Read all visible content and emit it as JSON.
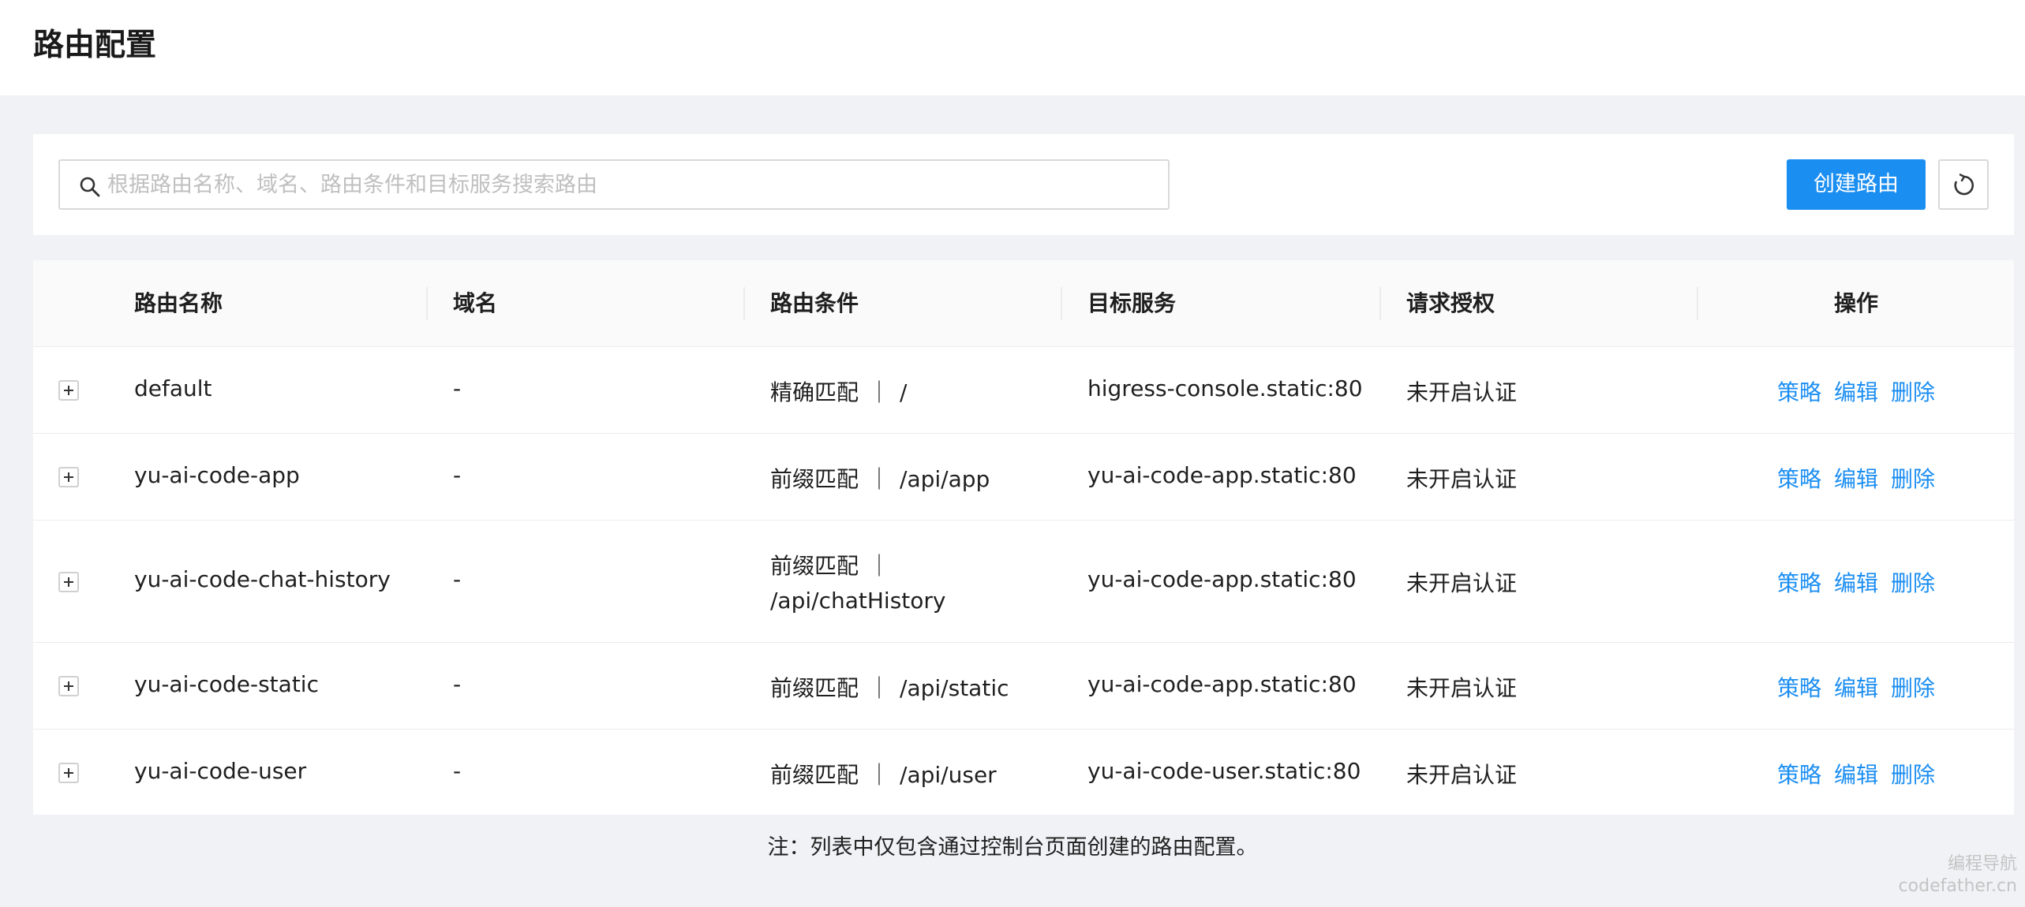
{
  "header": {
    "title": "路由配置"
  },
  "toolbar": {
    "search_placeholder": "根据路由名称、域名、路由条件和目标服务搜索路由",
    "create_label": "创建路由",
    "refresh_icon": "refresh-icon"
  },
  "table": {
    "columns": [
      "路由名称",
      "域名",
      "路由条件",
      "目标服务",
      "请求授权",
      "操作"
    ],
    "rows": [
      {
        "name": "default",
        "domain": "-",
        "match_type": "精确匹配",
        "match_sep": "｜",
        "match_path": "/",
        "service": "higress-console.static:80",
        "auth": "未开启认证"
      },
      {
        "name": "yu-ai-code-app",
        "domain": "-",
        "match_type": "前缀匹配",
        "match_sep": "｜",
        "match_path": "/api/app",
        "service": "yu-ai-code-app.static:80",
        "auth": "未开启认证"
      },
      {
        "name": "yu-ai-code-chat-history",
        "domain": "-",
        "match_type": "前缀匹配",
        "match_sep": "｜",
        "match_path": "/api/chatHistory",
        "service": "yu-ai-code-app.static:80",
        "auth": "未开启认证"
      },
      {
        "name": "yu-ai-code-static",
        "domain": "-",
        "match_type": "前缀匹配",
        "match_sep": "｜",
        "match_path": "/api/static",
        "service": "yu-ai-code-app.static:80",
        "auth": "未开启认证"
      },
      {
        "name": "yu-ai-code-user",
        "domain": "-",
        "match_type": "前缀匹配",
        "match_sep": "｜",
        "match_path": "/api/user",
        "service": "yu-ai-code-user.static:80",
        "auth": "未开启认证"
      }
    ],
    "actions": {
      "policy": "策略",
      "edit": "编辑",
      "delete": "删除"
    }
  },
  "note": "注：列表中仅包含通过控制台页面创建的路由配置。",
  "watermark": {
    "line1": "编程导航",
    "line2": "codefather.cn"
  },
  "colors": {
    "primary": "#1b8ef2",
    "background": "#f0f2f5"
  }
}
